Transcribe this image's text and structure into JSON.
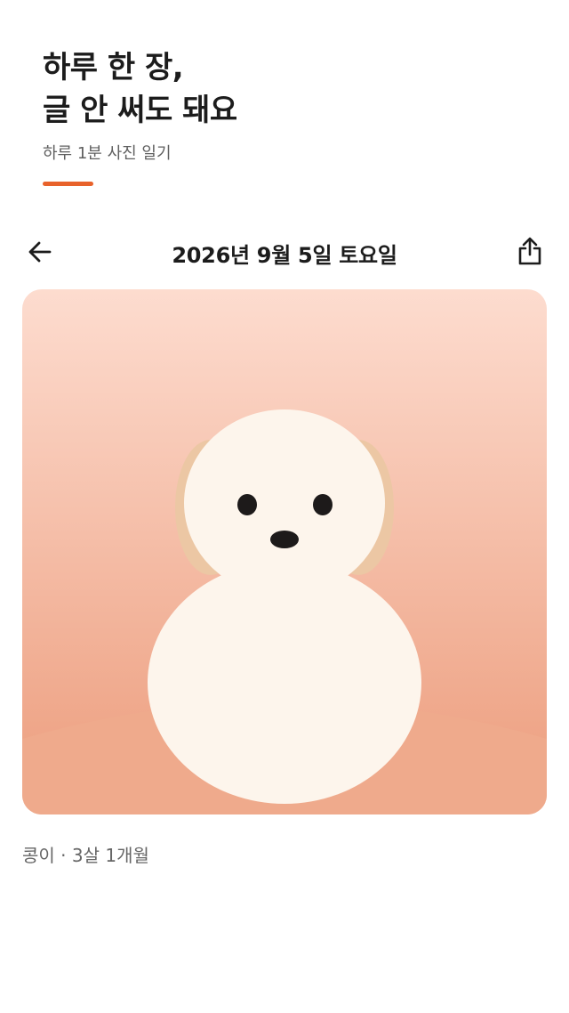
{
  "hero": {
    "title_line1": "하루 한 장,",
    "title_line2": "글 안 써도 돼요",
    "subtitle": "하루 1분 사진 일기",
    "accent_color": "#e8622b"
  },
  "entry": {
    "date": "2026년 9월 5일 토요일",
    "back_icon": "arrow-left-icon",
    "share_icon": "share-icon",
    "caption": "콩이 · 3살 1개월"
  },
  "colors": {
    "sky_top": "#fddccf",
    "sky_bottom": "#ec9c7c",
    "ground": "#efaa8c",
    "figure": "#fdf5ec",
    "ears": "#ecc7a4",
    "features": "#1d1a1a"
  }
}
